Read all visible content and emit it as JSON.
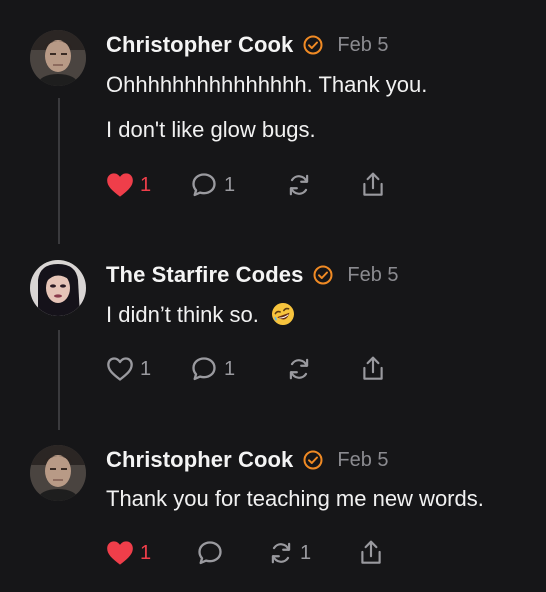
{
  "posts": [
    {
      "author": "Christopher Cook",
      "verified": true,
      "date": "Feb 5",
      "lines": [
        "Ohhhhhhhhhhhhhhh. Thank you.",
        "I don't like glow bugs."
      ],
      "actions": {
        "liked": true,
        "likes": "1",
        "replies": "1",
        "reposts": "",
        "share": ""
      }
    },
    {
      "author": "The Starfire Codes",
      "verified": true,
      "date": "Feb 5",
      "lines": [
        "I didn’t think so."
      ],
      "emoji": "rofl-emoji",
      "actions": {
        "liked": false,
        "likes": "1",
        "replies": "1",
        "reposts": "",
        "share": ""
      }
    },
    {
      "author": "Christopher Cook",
      "verified": true,
      "date": "Feb 5",
      "lines": [
        "Thank you for teaching me new words."
      ],
      "actions": {
        "liked": true,
        "likes": "1",
        "replies": "",
        "reposts": "1",
        "share": ""
      }
    }
  ],
  "colors": {
    "background": "#161618",
    "like_active": "#ef3e4a",
    "verified": "#f08a24",
    "muted": "#8b8b90"
  },
  "icons": [
    "heart-icon",
    "comment-icon",
    "repost-icon",
    "share-icon",
    "verified-badge-icon"
  ]
}
